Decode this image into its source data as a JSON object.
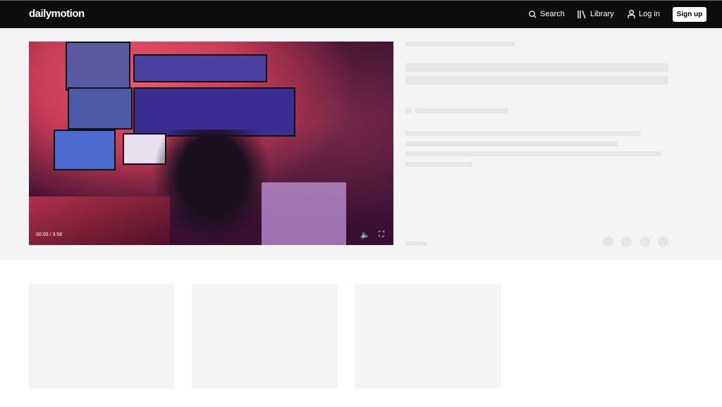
{
  "header": {
    "logo": "dailymotion",
    "search": "Search",
    "library": "Library",
    "login": "Log in",
    "signup": "Sign up"
  },
  "player": {
    "time": "00:00 / 3:58",
    "volume_icon": "speaker-icon",
    "fullscreen_icon": "fullscreen-icon"
  },
  "colors": {
    "header_bg": "#0d0d0d",
    "hero_bg": "#f4f4f4",
    "skeleton": "#e6e6e6"
  }
}
